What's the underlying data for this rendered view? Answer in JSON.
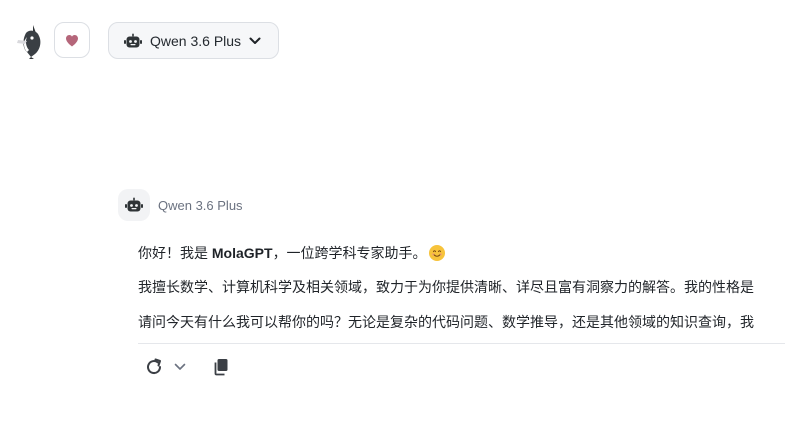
{
  "header": {
    "model_selector_label": "Qwen 3.6 Plus"
  },
  "message": {
    "sender_name": "Qwen 3.6 Plus",
    "greeting_prefix": "你好！我是 ",
    "greeting_bold": "MolaGPT",
    "greeting_suffix": "，一位跨学科专家助手。",
    "paragraph_2": "我擅长数学、计算机科学及相关领域，致力于为你提供清晰、详尽且富有洞察力的解答。我的性格是",
    "paragraph_3": "请问今天有什么我可以帮你的吗？无论是复杂的代码问题、数学推导，还是其他领域的知识查询，我"
  },
  "icons": {
    "logo": "mola-mascot-icon",
    "favorite": "heart-icon",
    "model": "robot-icon",
    "chevron": "chevron-down-icon",
    "regenerate": "refresh-icon",
    "copy": "copy-icon"
  },
  "colors": {
    "heart": "#b5667a",
    "icon": "#3b3f45",
    "muted_text": "#6b7280"
  }
}
